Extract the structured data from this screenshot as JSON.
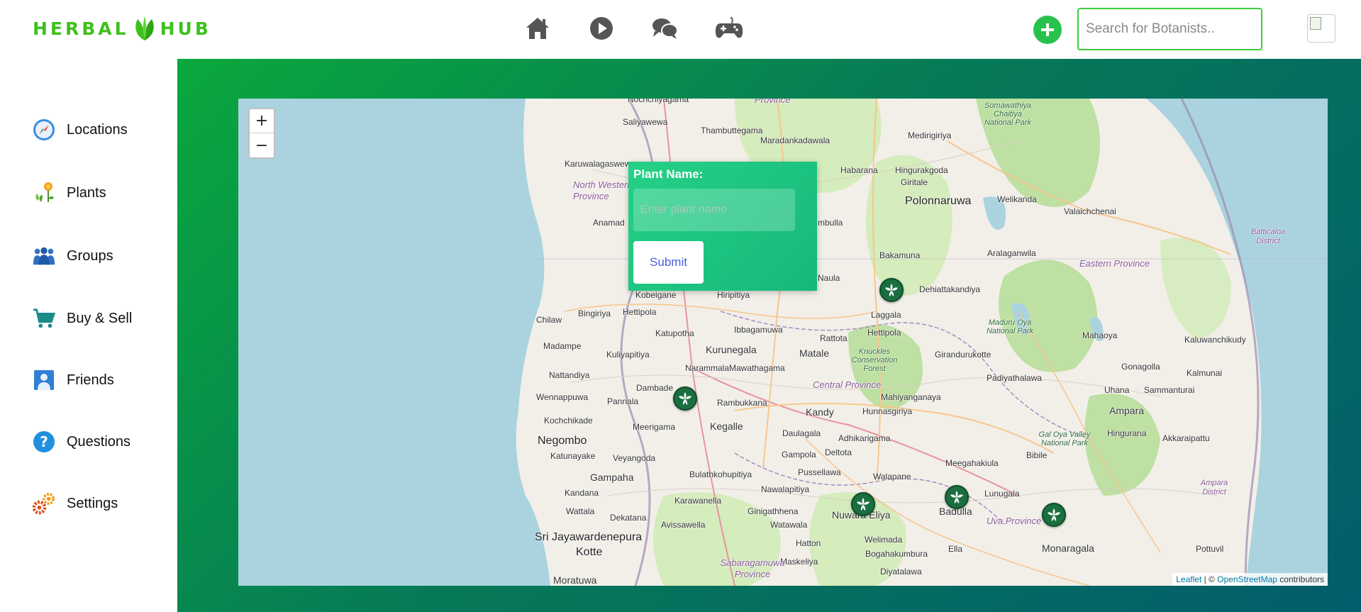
{
  "app": {
    "logo_left": "HERBAL",
    "logo_right": "HUB",
    "brand_color": "#3ec11d"
  },
  "topnav": {
    "icons": [
      "home-icon",
      "play-icon",
      "chat-icon",
      "gamepad-icon"
    ],
    "add_icon": "plus-icon",
    "search_placeholder": "Search for Botanists..",
    "avatar": "avatar"
  },
  "sidebar": {
    "items": [
      {
        "label": "Locations",
        "icon": "compass-icon"
      },
      {
        "label": "Plants",
        "icon": "flower-icon"
      },
      {
        "label": "Groups",
        "icon": "people-icon"
      },
      {
        "label": "Buy & Sell",
        "icon": "cart-icon"
      },
      {
        "label": "Friends",
        "icon": "person-icon"
      },
      {
        "label": "Questions",
        "icon": "question-icon"
      },
      {
        "label": "Settings",
        "icon": "gears-icon"
      }
    ]
  },
  "map": {
    "zoom_in": "+",
    "zoom_out": "−",
    "attribution": {
      "leaflet": "Leaflet",
      "separator": " | © ",
      "osm": "OpenStreetMap",
      "suffix": " contributors"
    },
    "places": {
      "nochchiyagama": "Nochchiyagama",
      "saliyawewa": "Saliyawewa",
      "thambuttegama": "Thambuttegama",
      "maradankadawala": "Maradankadawala",
      "medirigiriya": "Medirigiriya",
      "karuwalagaswewa": "Karuwalagaswewa",
      "habarana": "Habarana",
      "hingurakgoda": "Hingurakgoda",
      "giritale": "Giritale",
      "polonnaruwa": "Polonnaruwa",
      "welikanda": "Welikanda",
      "valaichchenai": "Valaichchenai",
      "anamaduwa": "Anamad",
      "dambulla": "mbulla",
      "bakamuna": "Bakamuna",
      "aralaganwila": "Aralaganwila",
      "naula": "Naula",
      "kobeigane": "Kobeigane",
      "hiripitiya": "Hiripitiya",
      "dehiattakandiya": "Dehiattakandiya",
      "bingiriya": "Bingiriya",
      "hettipola": "Hettipola",
      "chilaw": "Chilaw",
      "laggala": "Laggala",
      "hettipola2": "Hettipola",
      "mahaoya": "Mahaoya",
      "kaluwanchikudy": "Kaluwanchikudy",
      "katupotha": "Katupotha",
      "ibbagamuwa": "Ibbagamuwa",
      "rattota": "Rattota",
      "madampe": "Madampe",
      "kuliyapitiya": "Kuliyapitiya",
      "kurunegala": "Kurunegala",
      "matale": "Matale",
      "girandurukotte": "Girandurukotte",
      "gonagolla": "Gonagolla",
      "kalmunai": "Kalmunai",
      "narammala": "Narammala",
      "mawathagama": "Mawathagama",
      "nattandiya": "Nattandiya",
      "padiyathalawa": "Padiyathalawa",
      "dambadeniya": "Dambade",
      "wennappuwa": "Wennappuwa",
      "pannala": "Pannala",
      "rambukkana": "Rambukkana",
      "kandy": "Kandy",
      "mahiyanganaya": "Mahiyanganaya",
      "uhana": "Uhana",
      "sammanturai": "Sammanturai",
      "ampara": "Ampara",
      "kochchikade": "Kochchikade",
      "hunnasgiriya": "Hunnasgiriya",
      "meerigama": "Meerigama",
      "kegalle": "Kegalle",
      "daulagala": "Daulagala",
      "adhikarigama": "Adhikarigama",
      "negombo": "Negombo",
      "hingurana": "Hingurana",
      "akkaraipattu": "Akkaraipattu",
      "katunayake": "Katunayake",
      "veyangoda": "Veyangoda",
      "gampola": "Gampola",
      "deltota": "Deltota",
      "bibile": "Bibile",
      "meegahakiula": "Meegahakiula",
      "gampaha": "Gampaha",
      "bulathkohupitiya": "Bulathkohupitiya",
      "pussellawa": "Pussellawa",
      "walapane": "Walapane",
      "kandana": "Kandana",
      "karawanella": "Karawanella",
      "nawalapitiya": "Nawalapitiya",
      "lunugala": "Lunugala",
      "wattala": "Wattala",
      "ginigathhena": "Ginigathhena",
      "nuwaraeliya": "Nuwara Eliya",
      "badulla": "Badulla",
      "dekatana": "Dekatana",
      "avissawella": "Avissawella",
      "watawala": "Watawala",
      "sjk": "Sri Jayawardenepura",
      "kotte": "Kotte",
      "welimada": "Welimada",
      "monaragala": "Monaragala",
      "hatton": "Hatton",
      "bogahakumbura": "Bogahakumbura",
      "ella": "Ella",
      "pottuvil": "Pottuvil",
      "maskeliya": "Maskeliya",
      "moratuwa": "Moratuwa",
      "diyatalawa": "Diyatalawa",
      "nwp": "North Western Province",
      "eastern": "Eastern Province",
      "central": "Central Province",
      "uva": "Uva Province",
      "sabaragamuwa": "Sabaragamuwa Province",
      "batticaloa": "Batticaloa District",
      "ampara_d": "Ampara District",
      "somawathiya": "Somawathiya Chaitiya National Park",
      "maduru": "Maduru Oya National Park",
      "knuckles": "Knuckles Conservation Forest",
      "galoya": "Gal Oya Valley National Park",
      "province_top": "Province"
    },
    "markers": [
      "plant-marker-1",
      "plant-marker-2",
      "plant-marker-3",
      "plant-marker-4",
      "plant-marker-5"
    ]
  },
  "popup": {
    "label": "Plant Name:",
    "placeholder": "Enter plant name",
    "submit": "Submit"
  }
}
